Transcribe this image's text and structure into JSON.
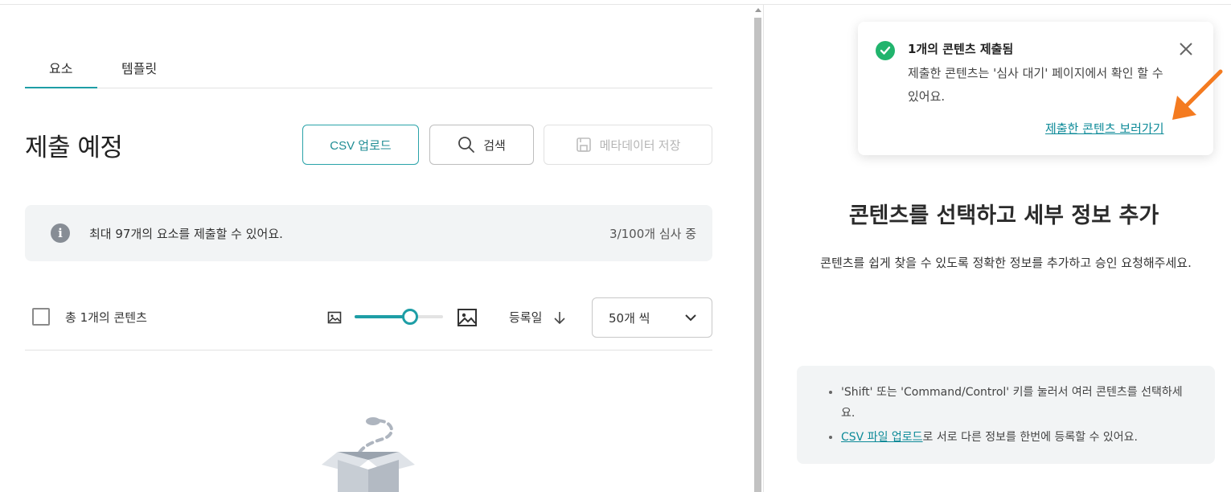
{
  "tabs": [
    {
      "label": "요소",
      "active": true
    },
    {
      "label": "템플릿",
      "active": false
    }
  ],
  "page_title": "제출 예정",
  "buttons": {
    "csv_upload": "CSV 업로드",
    "search": "검색",
    "save_metadata": "메타데이터 저장"
  },
  "info": {
    "text": "최대 97개의 요소를 제출할 수 있어요.",
    "count": "3/100개 심사 중"
  },
  "toolbar": {
    "total": "총 1개의 콘텐츠",
    "thumbnail_size": 0.63,
    "sort_label": "등록일",
    "per_page": "50개 씩"
  },
  "right": {
    "title": "콘텐츠를 선택하고 세부 정보 추가",
    "description": "콘텐츠를 쉽게 찾을 수 있도록 정확한 정보를 추가하고 승인 요청해주세요.",
    "tip1": "'Shift' 또는 'Command/Control' 키를 눌러서 여러 콘텐츠를 선택하세요.",
    "tip2_link": "CSV 파일 업로드",
    "tip2_rest": "로 서로 다른 정보를 한번에 등록할 수 있어요."
  },
  "toast": {
    "title": "1개의 콘텐츠 제출됨",
    "body": "제출한 콘텐츠는 '심사 대기' 페이지에서 확인 할 수 있어요.",
    "link": "제출한 콘텐츠 보러가기"
  },
  "colors": {
    "accent": "#1e9ea6",
    "success": "#21b46d",
    "annotation_arrow": "#f47b20"
  }
}
